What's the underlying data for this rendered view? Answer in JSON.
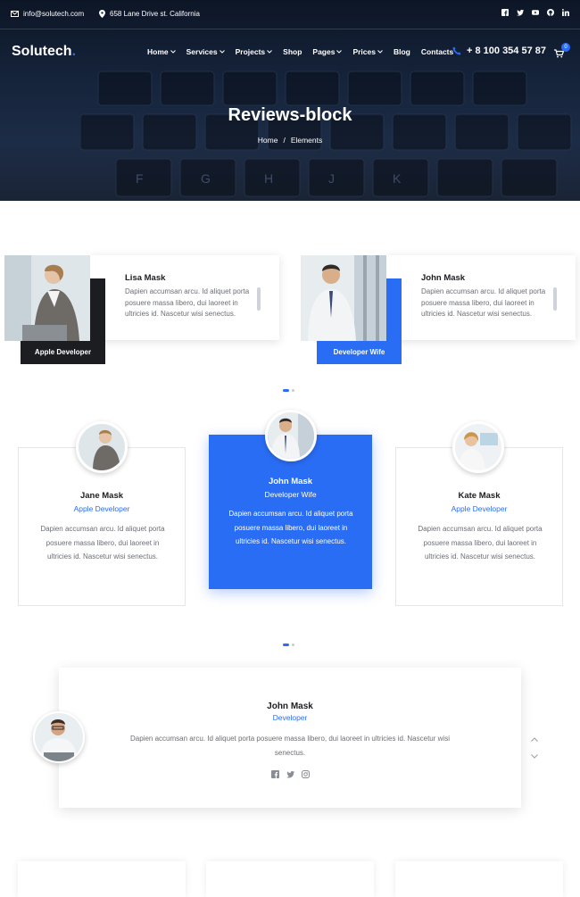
{
  "topbar": {
    "email": "info@solutech.com",
    "address": "658 Lane Drive st. California",
    "social": [
      "facebook-icon",
      "twitter-icon",
      "youtube-icon",
      "github-icon",
      "linkedin-icon"
    ]
  },
  "header": {
    "logo": "Solutech",
    "logo_dot": ".",
    "nav": [
      "Home",
      "Services",
      "Projects",
      "Shop",
      "Pages",
      "Prices",
      "Blog",
      "Contacts"
    ],
    "phone": "+ 8 100 354 57 87",
    "cart_count": "0"
  },
  "hero": {
    "title": "Reviews-block",
    "breadcrumb": [
      "Home",
      "Elements"
    ],
    "breadcrumb_sep": "/"
  },
  "slider1": {
    "reviews": [
      {
        "name": "Lisa Mask",
        "tag": "Apple Developer",
        "text": "Dapien accumsan arcu. Id aliquet porta posuere massa libero, dui laoreet in ultricies id. Nascetur wisi senectus."
      },
      {
        "name": "John Mask",
        "tag": "Developer Wife",
        "text": "Dapien accumsan arcu. Id aliquet porta posuere massa libero, dui laoreet in ultricies id. Nascetur wisi senectus."
      }
    ]
  },
  "slider2": {
    "reviews": [
      {
        "name": "Jane Mask",
        "role": "Apple Developer",
        "text": "Dapien accumsan arcu. Id aliquet porta posuere massa libero, dui laoreet in ultricies id. Nascetur wisi senectus."
      },
      {
        "name": "John Mask",
        "role": "Developer Wife",
        "text": "Dapien accumsan arcu. Id aliquet porta posuere massa libero, dui laoreet in ultricies id. Nascetur wisi senectus."
      },
      {
        "name": "Kate Mask",
        "role": "Apple Developer",
        "text": "Dapien accumsan arcu. Id aliquet porta posuere massa libero, dui laoreet in ultricies id. Nascetur wisi senectus."
      }
    ]
  },
  "slider3": {
    "name": "John Mask",
    "role": "Developer",
    "text": "Dapien accumsan arcu. Id aliquet porta posuere massa libero, dui laoreet in ultricies id. Nascetur wisi senectus.",
    "social": [
      "facebook-icon",
      "twitter-icon",
      "instagram-icon"
    ]
  },
  "colors": {
    "accent": "#2a6df5",
    "dark": "#1b1d21"
  }
}
